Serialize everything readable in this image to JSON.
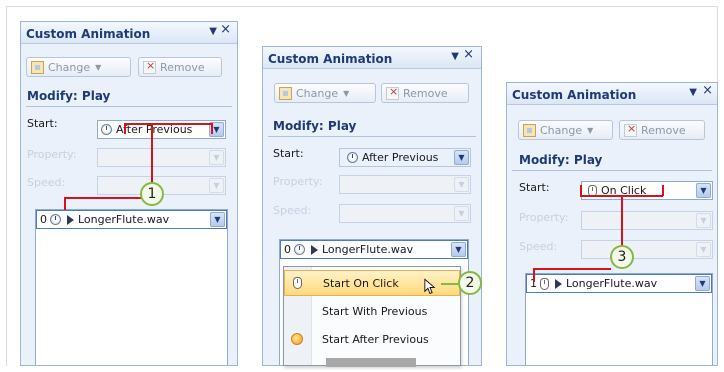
{
  "panels": [
    {
      "title": "Custom Animation",
      "header_dropdown_icon": "triangle-down",
      "close_glyph": "×",
      "change_label": "Change",
      "remove_label": "Remove",
      "section_title": "Modify: Play",
      "start_label": "Start:",
      "start_value": "After Previous",
      "property_label": "Property:",
      "speed_label": "Speed:",
      "list_item": {
        "order": "0",
        "name": "LongerFlute.wav"
      },
      "callout": "1"
    },
    {
      "title": "Custom Animation",
      "header_dropdown_icon": "triangle-down",
      "close_glyph": "×",
      "change_label": "Change",
      "remove_label": "Remove",
      "section_title": "Modify: Play",
      "start_label": "Start:",
      "start_value": "After Previous",
      "property_label": "Property:",
      "speed_label": "Speed:",
      "list_item": {
        "order": "0",
        "name": "LongerFlute.wav"
      },
      "menu": [
        {
          "label": "Start On Click",
          "highlighted": true,
          "icon": "mouse-icon"
        },
        {
          "label": "Start With Previous",
          "highlighted": false,
          "icon": ""
        },
        {
          "label": "Start After Previous",
          "highlighted": false,
          "icon": "bullet-icon"
        }
      ],
      "callout": "2"
    },
    {
      "title": "Custom Animation",
      "header_dropdown_icon": "triangle-down",
      "close_glyph": "×",
      "change_label": "Change",
      "remove_label": "Remove",
      "section_title": "Modify: Play",
      "start_label": "Start:",
      "start_value": "On Click",
      "property_label": "Property:",
      "speed_label": "Speed:",
      "list_item": {
        "order": "1",
        "name": "LongerFlute.wav"
      },
      "callout": "3"
    }
  ],
  "colors": {
    "panel_bg": "#eaf1fb",
    "title_blue": "#1f3a74",
    "callout_line": "#d4131b",
    "callout_ring": "#86b842",
    "menu_highlight": "#ffd97a"
  }
}
